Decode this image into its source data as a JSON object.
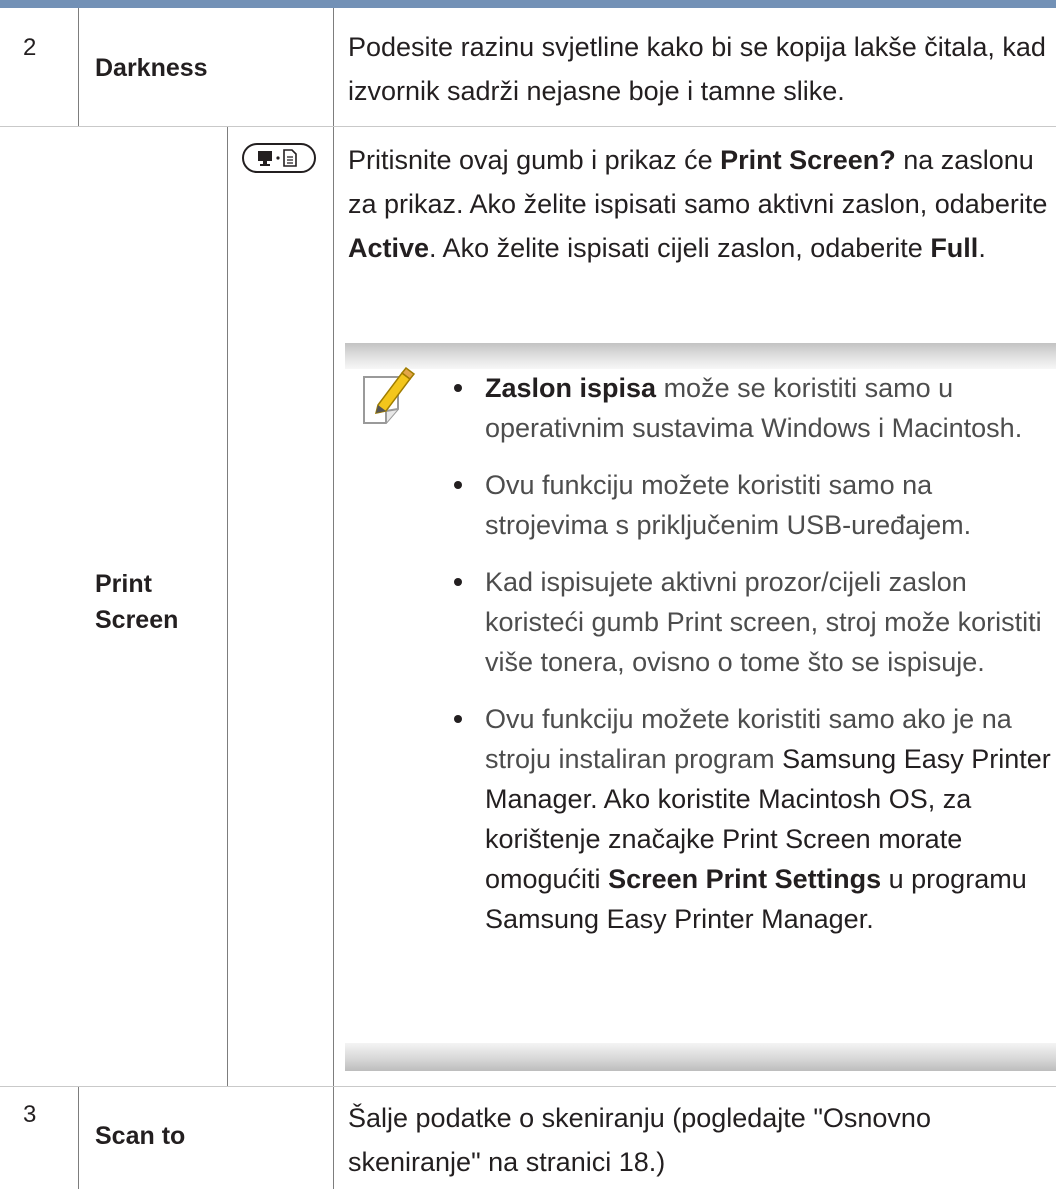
{
  "rows": [
    {
      "number": "2",
      "label": "Darkness",
      "description": "Podesite razinu svjetline kako bi se kopija lakše čitala, kad izvornik sadrži nejasne boje i tamne slike."
    },
    {
      "label": "Print Screen",
      "button_icon": "print-screen-button-icon",
      "description_parts": [
        "Pritisnite ovaj gumb i prikaz će ",
        "Print Screen?",
        " na zaslonu za prikaz. Ako želite ispisati samo aktivni zaslon, odaberite ",
        "Active",
        ". Ako želite ispisati cijeli zaslon, odaberite ",
        "Full",
        "."
      ],
      "note": {
        "icon": "note-pencil-icon",
        "bullets": [
          {
            "bold": "Zaslon ispisa",
            "text": " može se koristiti samo u operativnim sustavima Windows i Macintosh."
          },
          {
            "text": "Ovu funkciju možete koristiti samo na strojevima s priključenim USB-uređajem."
          },
          {
            "text": "Kad ispisujete aktivni prozor/cijeli zaslon koristeći gumb Print screen, stroj može koristiti više tonera, ovisno o tome što se ispisuje."
          },
          {
            "parts": [
              "Ovu funkciju možete koristiti samo ako je na stroju instaliran program ",
              "Samsung Easy Printer Manager",
              ". Ako koristite Macintosh OS, za korištenje značajke Print Screen morate omogućiti ",
              "Screen Print Settings",
              " u programu Samsung Easy Printer Manager."
            ]
          }
        ]
      }
    },
    {
      "number": "3",
      "label": "Scan to",
      "description": "Šalje podatke o skeniranju (pogledajte \"Osnovno skeniranje\" na stranici 18.)"
    }
  ],
  "colors": {
    "top_rule": "#7391b6",
    "text": "#231f20",
    "note_text": "#4d4d4d"
  }
}
